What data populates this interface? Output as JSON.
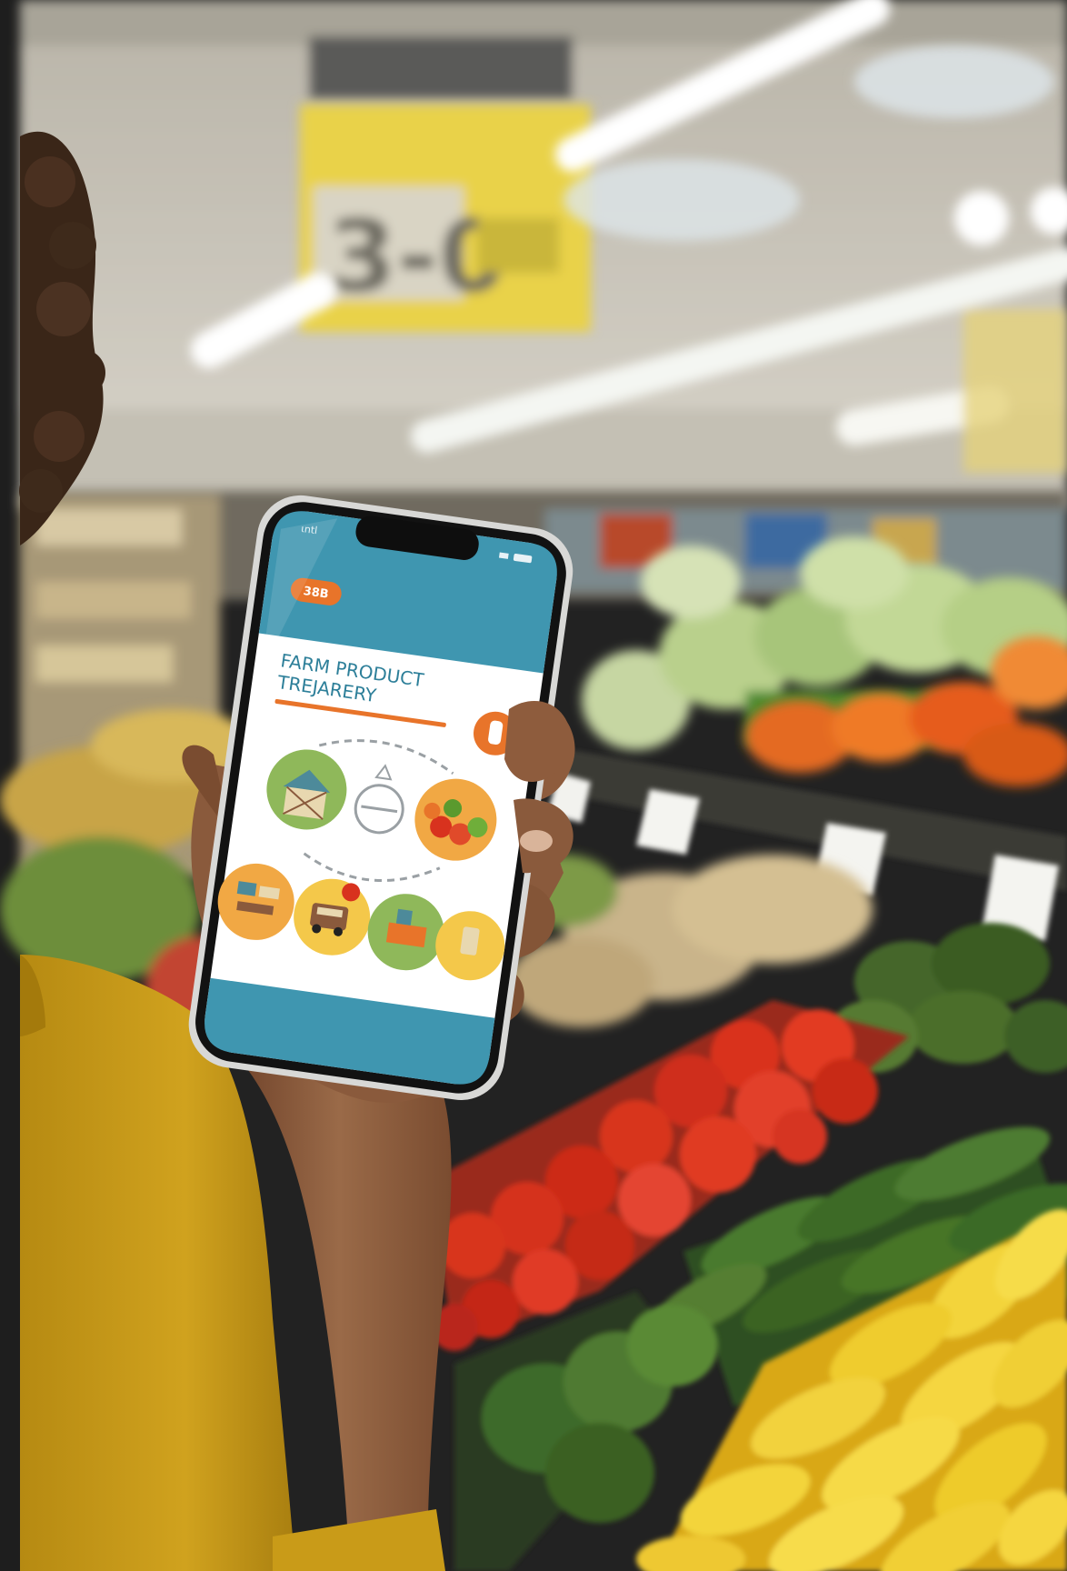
{
  "scene": {
    "sign": {
      "text": "3-0"
    },
    "phone": {
      "status_carrier": "ιntl",
      "badge": "38B",
      "title_line1": "FARM PRODUCT",
      "title_line2": "TREJARERY",
      "accent_color": "#e8742a",
      "header_color": "#3f96b0",
      "icons": [
        "barn-icon",
        "cycle-arrows-icon",
        "vegetables-icon",
        "market-stall-icon",
        "delivery-truck-icon",
        "grocer-icon",
        "jar-icon",
        "bottle-icon"
      ]
    },
    "colors": {
      "sweater": "#c99b18",
      "skin": "#8a5a3c",
      "tomato": "#d8301f",
      "banana": "#f0cc2c",
      "cucumber": "#3f6a2c",
      "ceiling": "#cfcbc0"
    }
  }
}
